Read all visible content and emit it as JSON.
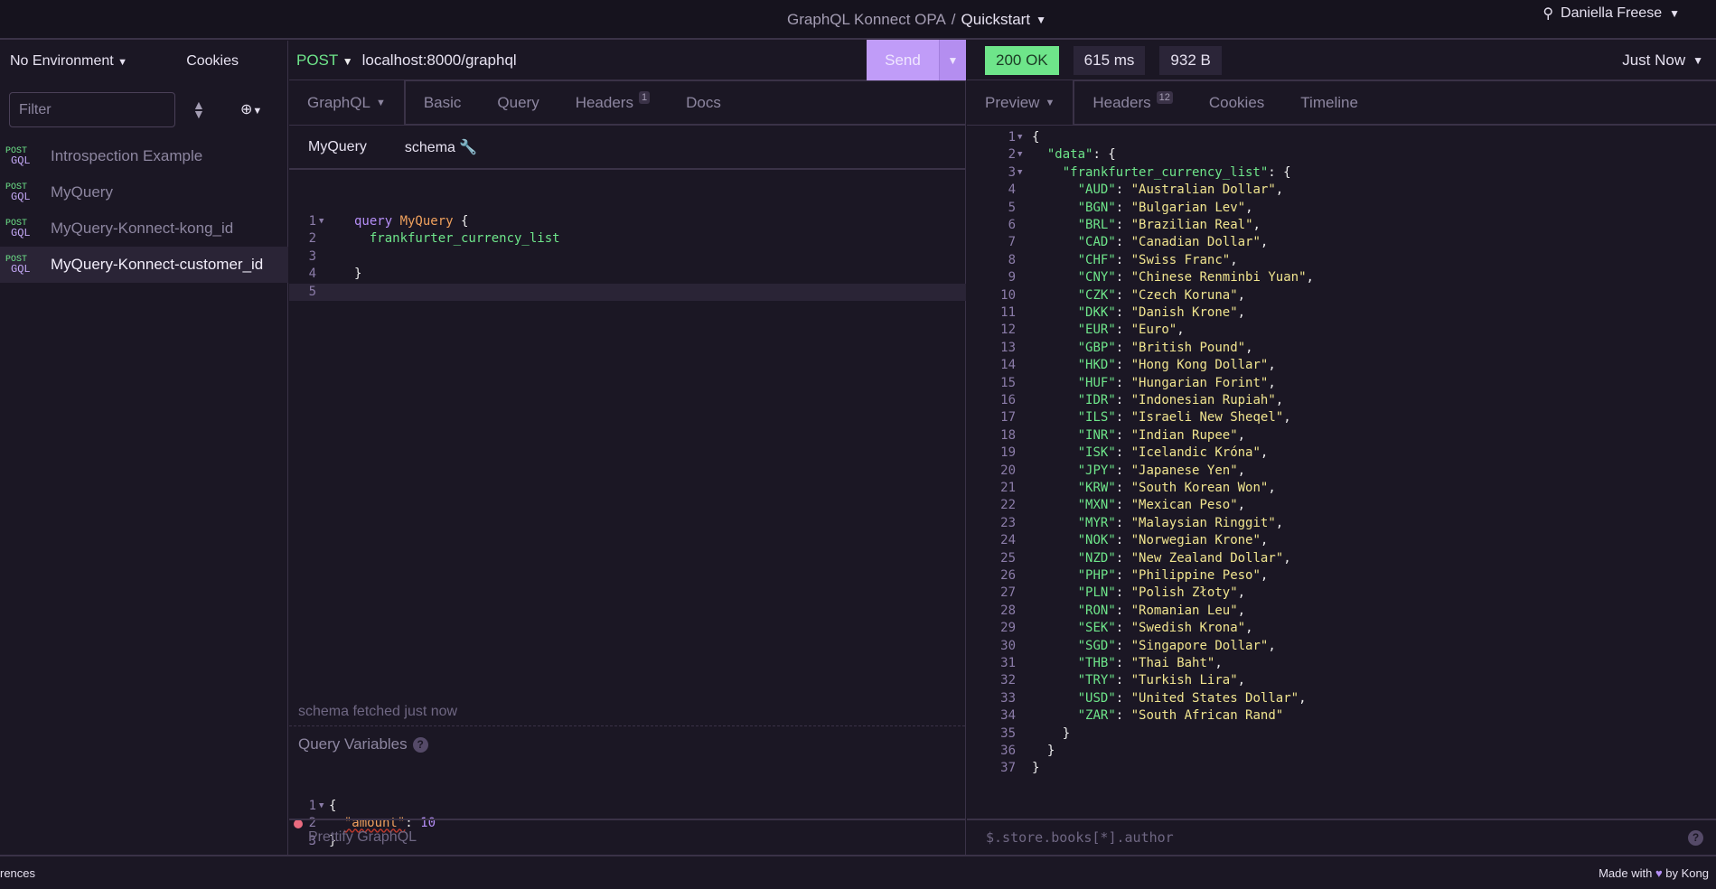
{
  "titlebar": {
    "project": "GraphQL Konnect OPA",
    "separator": "/",
    "workspace": "Quickstart",
    "user": "Daniella Freese"
  },
  "sidebar": {
    "environment": "No Environment",
    "cookies": "Cookies",
    "filter_placeholder": "Filter",
    "items": [
      {
        "method": "POST",
        "type": "GQL",
        "label": "Introspection Example"
      },
      {
        "method": "POST",
        "type": "GQL",
        "label": "MyQuery"
      },
      {
        "method": "POST",
        "type": "GQL",
        "label": "MyQuery-Konnect-kong_id"
      },
      {
        "method": "POST",
        "type": "GQL",
        "label": "MyQuery-Konnect-customer_id",
        "active": true
      }
    ]
  },
  "request": {
    "method": "POST",
    "url": "localhost:8000/graphql",
    "send": "Send",
    "tabs": [
      {
        "label": "GraphQL"
      },
      {
        "label": "Basic"
      },
      {
        "label": "Query"
      },
      {
        "label": "Headers",
        "count": "1"
      },
      {
        "label": "Docs"
      }
    ],
    "subtabs": {
      "operation": "MyQuery",
      "schema": "schema"
    },
    "query_lines": [
      [
        "query ",
        "MyQuery",
        " {"
      ],
      [
        "  frankfurter_currency_list"
      ],
      [
        ""
      ],
      [
        "}"
      ],
      [
        ""
      ]
    ],
    "schema_status": "schema fetched just now",
    "vars_label": "Query Variables",
    "vars_lines": [
      "{",
      "  \"amount\": 10",
      "}"
    ],
    "var_key": "\"amount\"",
    "var_value": "10",
    "prettify": "Prettify GraphQL"
  },
  "response": {
    "status": "200 OK",
    "time": "615 ms",
    "size": "932 B",
    "when": "Just Now",
    "tabs": [
      {
        "label": "Preview"
      },
      {
        "label": "Headers",
        "count": "12"
      },
      {
        "label": "Cookies"
      },
      {
        "label": "Timeline"
      }
    ],
    "root_key": "\"data\"",
    "list_key": "\"frankfurter_currency_list\"",
    "currencies": [
      [
        "AUD",
        "Australian Dollar"
      ],
      [
        "BGN",
        "Bulgarian Lev"
      ],
      [
        "BRL",
        "Brazilian Real"
      ],
      [
        "CAD",
        "Canadian Dollar"
      ],
      [
        "CHF",
        "Swiss Franc"
      ],
      [
        "CNY",
        "Chinese Renminbi Yuan"
      ],
      [
        "CZK",
        "Czech Koruna"
      ],
      [
        "DKK",
        "Danish Krone"
      ],
      [
        "EUR",
        "Euro"
      ],
      [
        "GBP",
        "British Pound"
      ],
      [
        "HKD",
        "Hong Kong Dollar"
      ],
      [
        "HUF",
        "Hungarian Forint"
      ],
      [
        "IDR",
        "Indonesian Rupiah"
      ],
      [
        "ILS",
        "Israeli New Sheqel"
      ],
      [
        "INR",
        "Indian Rupee"
      ],
      [
        "ISK",
        "Icelandic Króna"
      ],
      [
        "JPY",
        "Japanese Yen"
      ],
      [
        "KRW",
        "South Korean Won"
      ],
      [
        "MXN",
        "Mexican Peso"
      ],
      [
        "MYR",
        "Malaysian Ringgit"
      ],
      [
        "NOK",
        "Norwegian Krone"
      ],
      [
        "NZD",
        "New Zealand Dollar"
      ],
      [
        "PHP",
        "Philippine Peso"
      ],
      [
        "PLN",
        "Polish Złoty"
      ],
      [
        "RON",
        "Romanian Leu"
      ],
      [
        "SEK",
        "Swedish Krona"
      ],
      [
        "SGD",
        "Singapore Dollar"
      ],
      [
        "THB",
        "Thai Baht"
      ],
      [
        "TRY",
        "Turkish Lira"
      ],
      [
        "USD",
        "United States Dollar"
      ],
      [
        "ZAR",
        "South African Rand"
      ]
    ],
    "filter_placeholder": "$.store.books[*].author"
  },
  "footer": {
    "left": "rences",
    "made_with": "Made with",
    "by": "by Kong"
  },
  "colors": {
    "accent": "#c09cf8",
    "success": "#6ee58a",
    "background": "#1b1724"
  }
}
